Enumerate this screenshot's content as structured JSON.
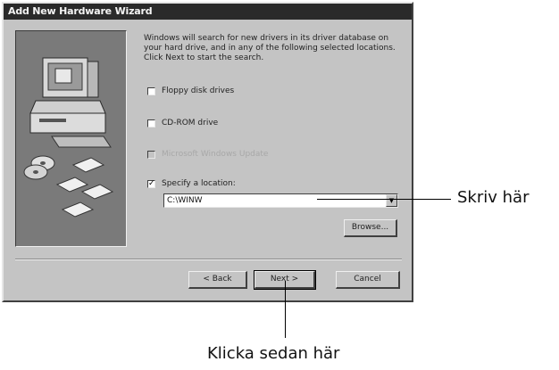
{
  "window": {
    "title": "Add New Hardware Wizard"
  },
  "instructions": "Windows will search for new drivers in its driver database on your hard drive, and in any of the following selected locations. Click Next to start the search.",
  "options": [
    {
      "label": "Floppy disk drives",
      "checked": false,
      "enabled": true
    },
    {
      "label": "CD-ROM drive",
      "checked": false,
      "enabled": true
    },
    {
      "label": "Microsoft Windows Update",
      "checked": false,
      "enabled": false
    },
    {
      "label": "Specify a location:",
      "checked": true,
      "enabled": true
    }
  ],
  "location": {
    "value": "C:\\WINW"
  },
  "buttons": {
    "browse": "Browse...",
    "back": "< Back",
    "next": "Next >",
    "cancel": "Cancel"
  },
  "annotations": {
    "type_here": "Skriv här",
    "then_click_here": "Klicka sedan här"
  },
  "icons": {
    "wizard_art": "computer-with-discs-icon",
    "check": "checkmark-icon",
    "dropdown": "chevron-down-icon"
  }
}
